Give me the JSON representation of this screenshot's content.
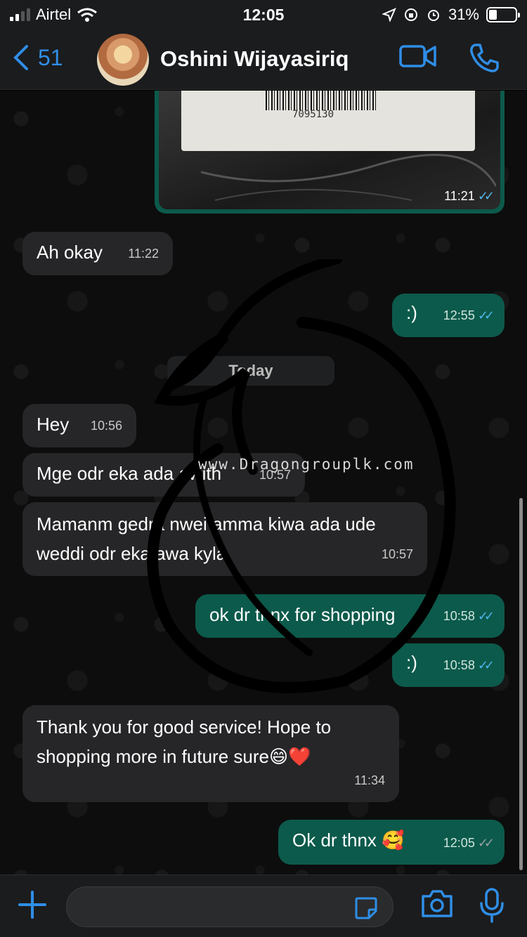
{
  "status_bar": {
    "carrier": "Airtel",
    "time": "12:05",
    "battery_percent": "31%",
    "battery_level": 0.31
  },
  "header": {
    "back_count": "51",
    "contact_name": "Oshini Wijayasiriq"
  },
  "messages": [
    {
      "direction": "out",
      "type": "image",
      "image_caption": "7095130",
      "time": "11:21",
      "status": "read"
    },
    {
      "direction": "in",
      "text": "Ah okay",
      "time": "11:22"
    },
    {
      "direction": "out",
      "text": ":)",
      "time": "12:55",
      "status": "read"
    },
    {
      "direction": "in",
      "text": "Hey",
      "time": "10:56"
    },
    {
      "direction": "in",
      "text": "Mge odr eka ada awith",
      "time": "10:57"
    },
    {
      "direction": "in",
      "text": "Mamanm gedra nwei amma kiwa ada ude weddi odr eka awa kyla",
      "time": "10:57"
    },
    {
      "direction": "out",
      "text": "ok dr thnx for shopping",
      "time": "10:58",
      "status": "read"
    },
    {
      "direction": "out",
      "text": ":)",
      "time": "10:58",
      "status": "read"
    },
    {
      "direction": "in",
      "text": "Thank you for good service! Hope to shopping more in future sure😄❤️",
      "time": "11:34"
    },
    {
      "direction": "out",
      "text": "Ok dr thnx 🥰",
      "time": "12:05",
      "status": "delivered"
    }
  ],
  "date_separator": "Today",
  "watermark": "www.Dragongrouplk.com",
  "colors": {
    "accent": "#2f8ee6",
    "outgoing_bubble": "#0c5a4b",
    "incoming_bubble": "#262628",
    "read_ticks": "#4fb6ec"
  },
  "icons": {
    "header": [
      "back-chevron-icon",
      "video-call-icon",
      "phone-icon"
    ],
    "input": [
      "plus-icon",
      "sticker-icon",
      "camera-icon",
      "microphone-icon"
    ]
  }
}
